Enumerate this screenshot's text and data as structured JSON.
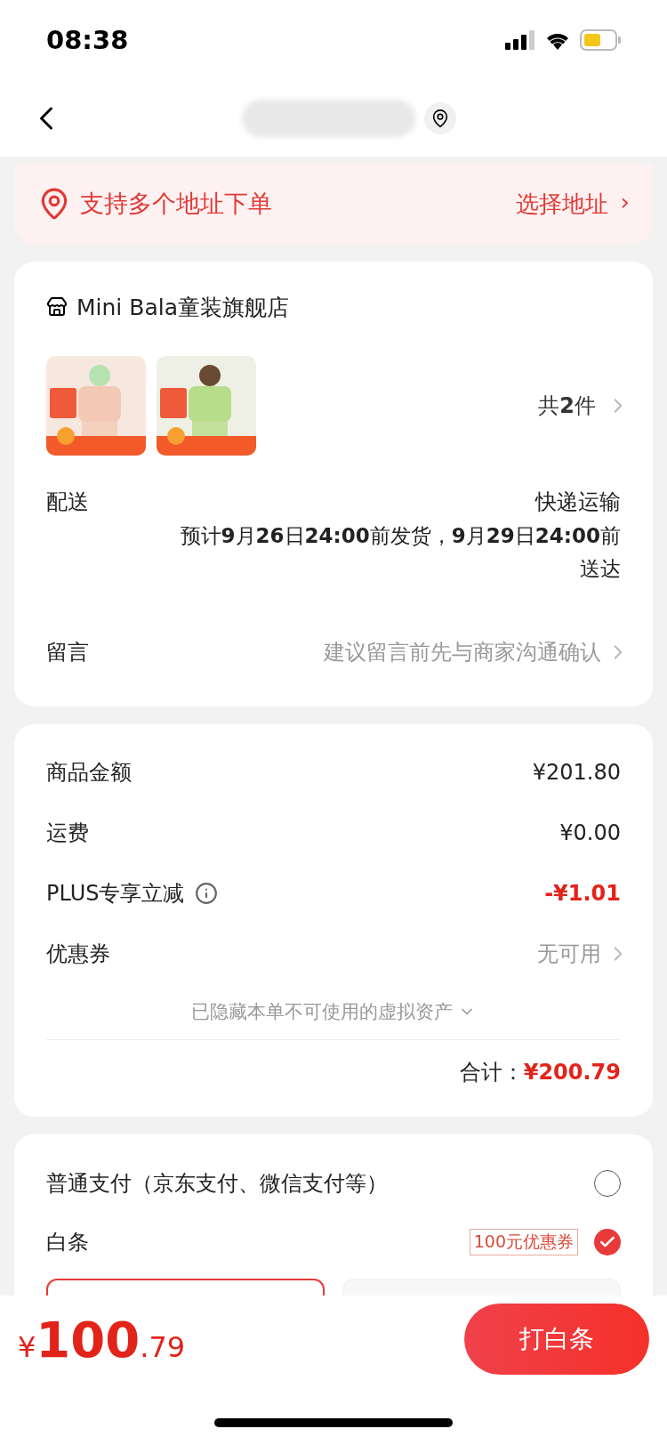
{
  "status_bar": {
    "time": "08:38"
  },
  "address_banner": {
    "text": "支持多个地址下单",
    "action": "选择地址",
    "action_arrow": "›"
  },
  "store": {
    "name": "Mini Bala童装旗舰店",
    "count": "共**2**件"
  },
  "delivery": {
    "label": "配送",
    "method": "快递运输",
    "estimate": "预计**9**月**26**日**24:00**前发货，**9**月**29**日**24:00**前送达"
  },
  "message": {
    "label": "留言",
    "placeholder": "建议留言前先与商家沟通确认"
  },
  "summary": {
    "rows": [
      {
        "label": "商品金额",
        "value": "¥201.80",
        "kind": "amount"
      },
      {
        "label": "运费",
        "value": "¥0.00",
        "kind": "amount"
      },
      {
        "label": "PLUS专享立减",
        "value": "-¥1.01",
        "kind": "discount",
        "info": true
      },
      {
        "label": "优惠券",
        "value": "无可用",
        "kind": "link"
      }
    ],
    "hidden_note": "已隐藏本单不可使用的虚拟资产",
    "total_label": "合计：",
    "total_value": "¥200.79"
  },
  "payment": {
    "options": [
      {
        "label": "普通支付（京东支付、微信支付等）",
        "selected": false
      },
      {
        "label": "白条",
        "tag": "100元优惠券",
        "selected": true
      }
    ]
  },
  "bottom_bar": {
    "currency": "¥",
    "price_main": "100",
    "price_fraction": ".79",
    "button": "打白条"
  }
}
